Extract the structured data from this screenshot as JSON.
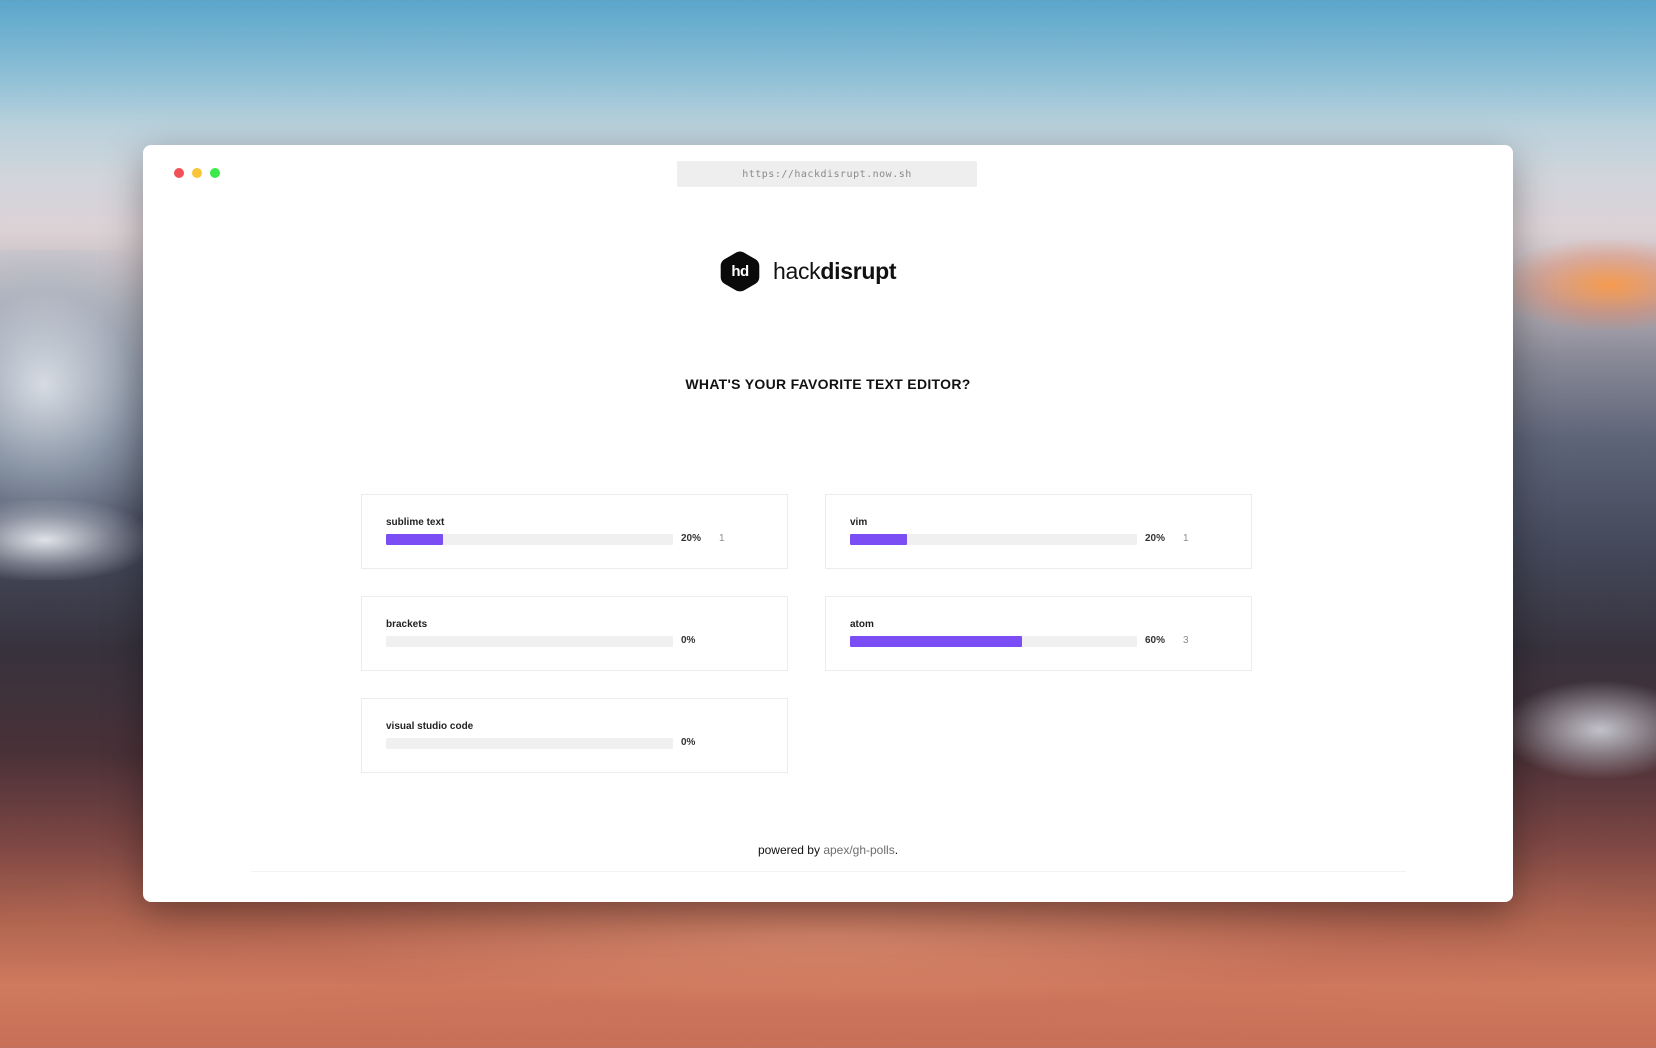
{
  "browser": {
    "url": "https://hackdisrupt.now.sh"
  },
  "brand": {
    "mark": "hd",
    "name_light": "hack",
    "name_bold": "disrupt"
  },
  "poll": {
    "question": "WHAT'S YOUR FAVORITE TEXT EDITOR?",
    "accent_color": "#7b4df4",
    "options": [
      {
        "name": "sublime text",
        "percent_label": "20%",
        "fraction": 0.2,
        "count": "1"
      },
      {
        "name": "vim",
        "percent_label": "20%",
        "fraction": 0.2,
        "count": "1"
      },
      {
        "name": "brackets",
        "percent_label": "0%",
        "fraction": 0.0,
        "count": ""
      },
      {
        "name": "atom",
        "percent_label": "60%",
        "fraction": 0.6,
        "count": "3"
      },
      {
        "name": "visual studio code",
        "percent_label": "0%",
        "fraction": 0.0,
        "count": ""
      }
    ]
  },
  "footer": {
    "prefix": "powered by ",
    "link": "apex/gh-polls",
    "suffix": "."
  }
}
